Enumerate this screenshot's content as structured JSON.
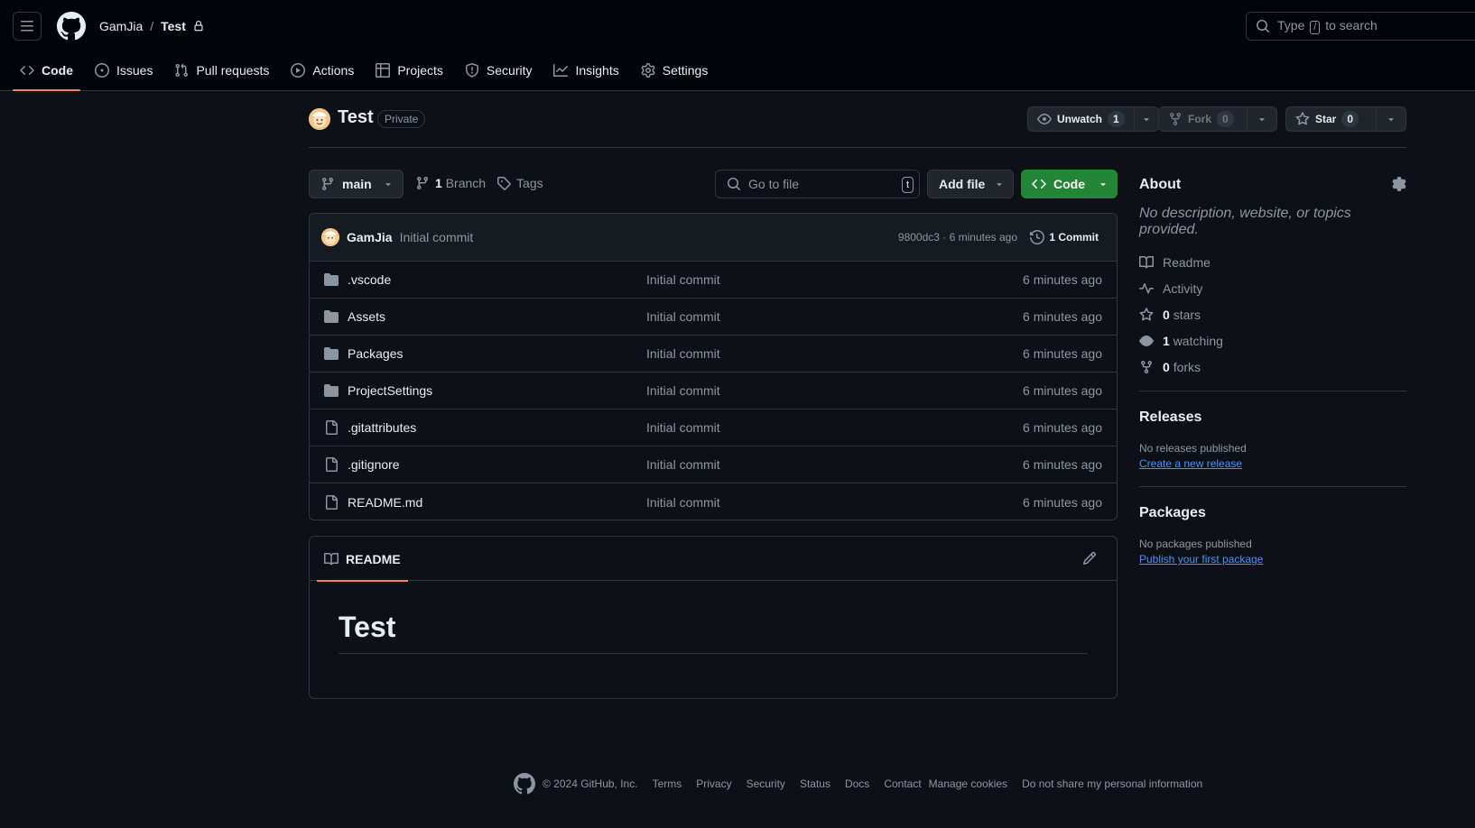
{
  "header": {
    "owner": "GamJia",
    "separator": "/",
    "repo": "Test",
    "search_prefix": "Type",
    "search_key": "/",
    "search_suffix": "to search"
  },
  "tabs": [
    {
      "label": "Code",
      "icon": "code-icon"
    },
    {
      "label": "Issues",
      "icon": "issue-icon"
    },
    {
      "label": "Pull requests",
      "icon": "pull-request-icon"
    },
    {
      "label": "Actions",
      "icon": "play-icon"
    },
    {
      "label": "Projects",
      "icon": "table-icon"
    },
    {
      "label": "Security",
      "icon": "shield-icon"
    },
    {
      "label": "Insights",
      "icon": "graph-icon"
    },
    {
      "label": "Settings",
      "icon": "gear-icon"
    }
  ],
  "repo_head": {
    "name": "Test",
    "visibility": "Private",
    "unwatch_label": "Unwatch",
    "unwatch_count": "1",
    "fork_label": "Fork",
    "fork_count": "0",
    "star_label": "Star",
    "star_count": "0"
  },
  "toolbar": {
    "branch": "main",
    "branch_count": "1",
    "branch_label": "Branch",
    "tags_label": "Tags",
    "goto_placeholder": "Go to file",
    "goto_key": "t",
    "add_file": "Add file",
    "code": "Code"
  },
  "commit": {
    "author": "GamJia",
    "message": "Initial commit",
    "meta": "9800dc3 · 6 minutes ago",
    "count": "1 Commit"
  },
  "files": [
    {
      "name": ".vscode",
      "type": "folder",
      "message": "Initial commit",
      "time": "6 minutes ago"
    },
    {
      "name": "Assets",
      "type": "folder",
      "message": "Initial commit",
      "time": "6 minutes ago"
    },
    {
      "name": "Packages",
      "type": "folder",
      "message": "Initial commit",
      "time": "6 minutes ago"
    },
    {
      "name": "ProjectSettings",
      "type": "folder",
      "message": "Initial commit",
      "time": "6 minutes ago"
    },
    {
      "name": ".gitattributes",
      "type": "file",
      "message": "Initial commit",
      "time": "6 minutes ago"
    },
    {
      "name": ".gitignore",
      "type": "file",
      "message": "Initial commit",
      "time": "6 minutes ago"
    },
    {
      "name": "README.md",
      "type": "file",
      "message": "Initial commit",
      "time": "6 minutes ago"
    }
  ],
  "readme": {
    "tab_label": "README",
    "title": "Test"
  },
  "about": {
    "heading": "About",
    "description": "No description, website, or topics provided.",
    "readme": "Readme",
    "activity": "Activity",
    "stars_count": "0",
    "stars_label": "stars",
    "watching_count": "1",
    "watching_label": "watching",
    "forks_count": "0",
    "forks_label": "forks"
  },
  "releases": {
    "heading": "Releases",
    "status": "No releases published",
    "link": "Create a new release"
  },
  "packages": {
    "heading": "Packages",
    "status": "No packages published",
    "link": "Publish your first package"
  },
  "footer": {
    "copyright": "© 2024 GitHub, Inc.",
    "links": [
      "Terms",
      "Privacy",
      "Security",
      "Status",
      "Docs",
      "Contact",
      "Manage cookies",
      "Do not share my personal information"
    ]
  },
  "colors": {
    "accent_green": "#238636",
    "link_blue": "#4493f8",
    "tab_underline": "#f78166",
    "background": "#0d1117"
  }
}
